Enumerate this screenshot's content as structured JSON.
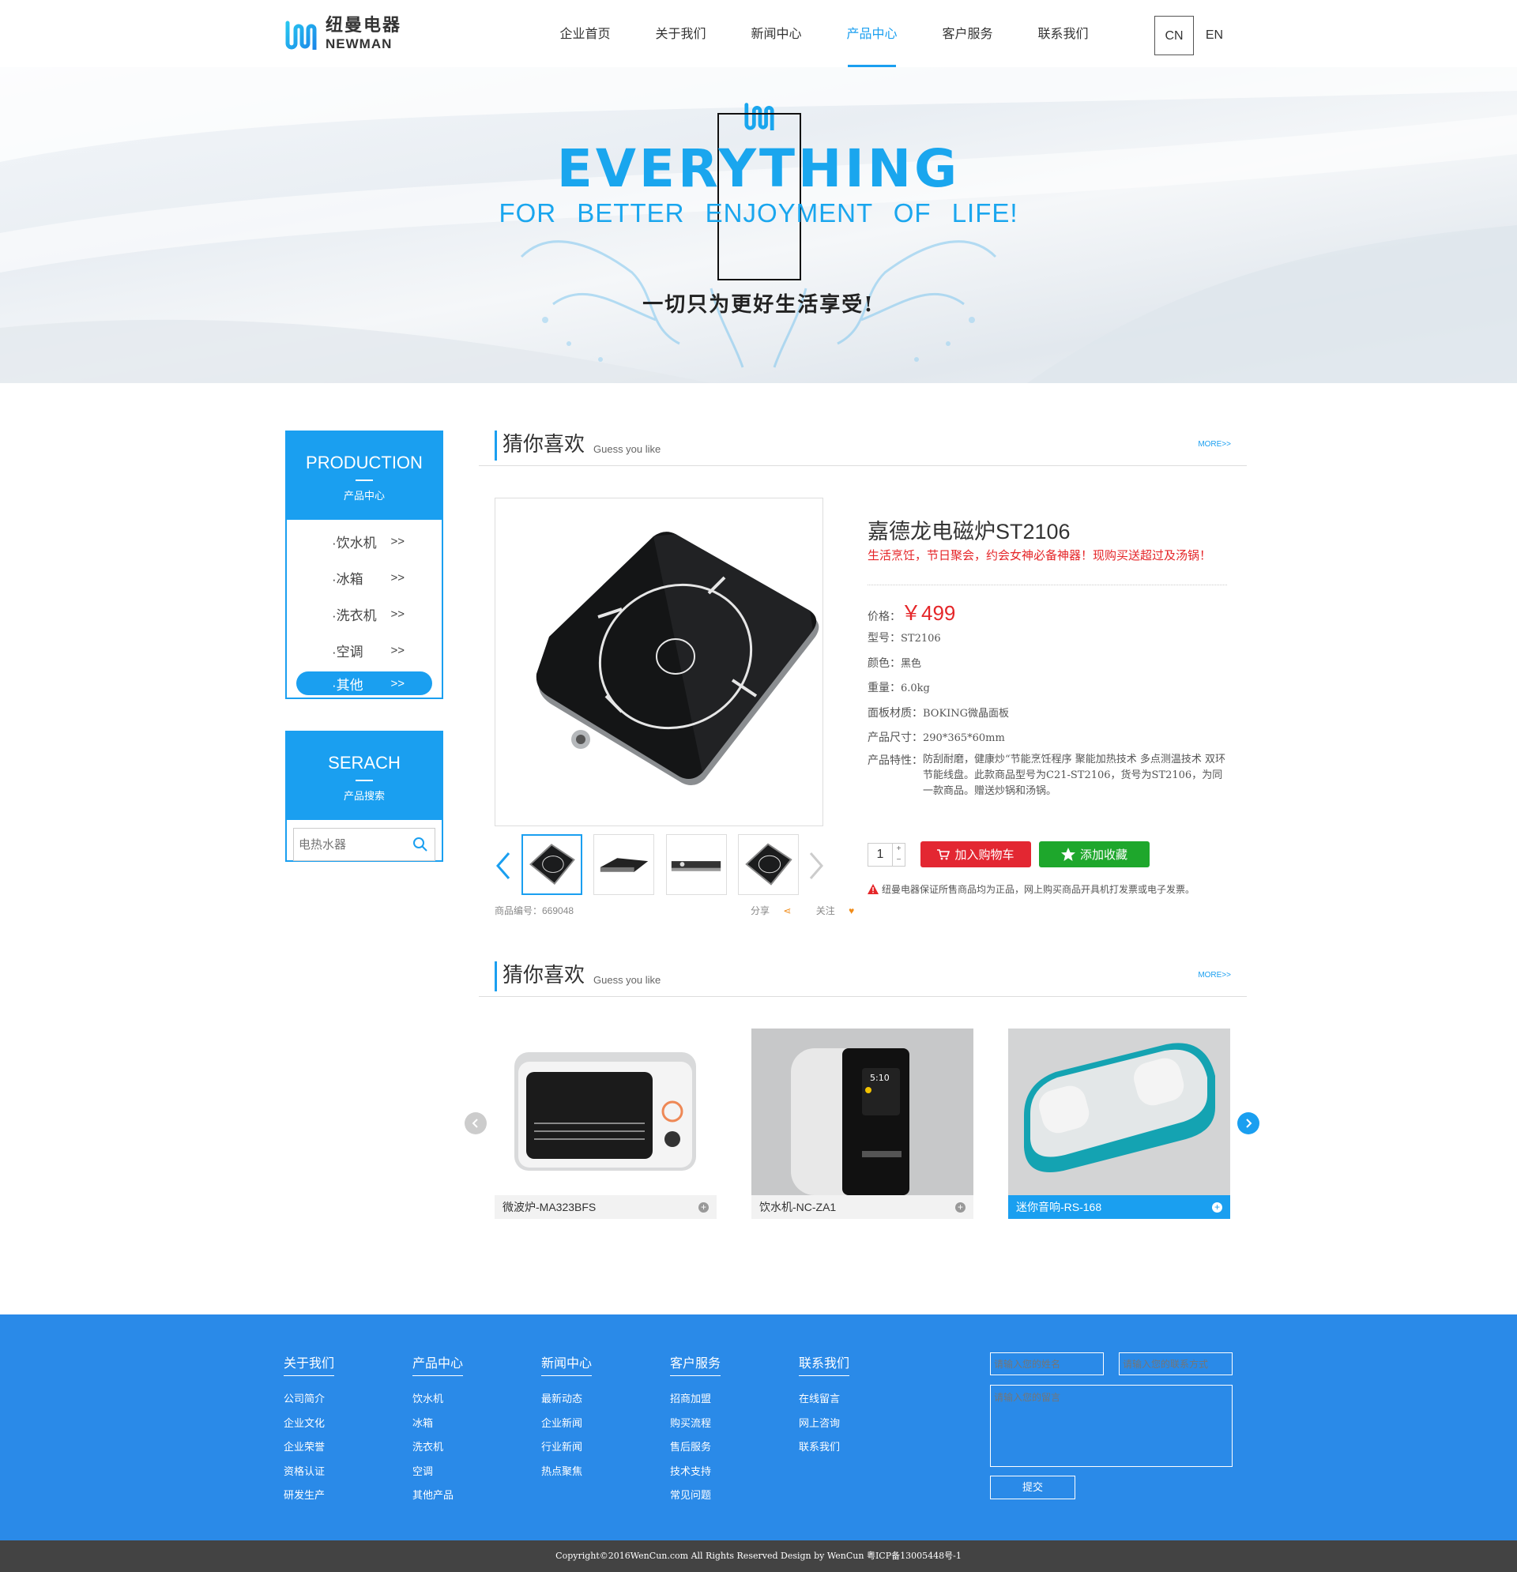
{
  "header": {
    "logo_cn": "纽曼电器",
    "logo_en": "NEWMAN",
    "nav": [
      "企业首页",
      "关于我们",
      "新闻中心",
      "产品中心",
      "客户服务",
      "联系我们"
    ],
    "active_nav": "产品中心",
    "lang": [
      "CN",
      "EN"
    ]
  },
  "banner": {
    "title": "EVERYTHING",
    "subtitle": "FOR BETTER ENJOYMENT OF LIFE!",
    "tagline_cn": "一切只为更好生活享受!"
  },
  "sidebar": {
    "production": {
      "title": "PRODUCTION",
      "subtitle": "产品中心",
      "items": [
        {
          "label": "·饮水机",
          "arrow": ">>"
        },
        {
          "label": "·冰箱",
          "arrow": ">>"
        },
        {
          "label": "·洗衣机",
          "arrow": ">>"
        },
        {
          "label": "·空调",
          "arrow": ">>"
        },
        {
          "label": "·其他",
          "arrow": ">>"
        }
      ],
      "active_item": "·其他"
    },
    "search": {
      "title": "SERACH",
      "subtitle": "产品搜索",
      "placeholder": "电热水器"
    }
  },
  "section1": {
    "title": "猜你喜欢",
    "subtitle": "Guess you like",
    "more": "MORE>>"
  },
  "product": {
    "title": "嘉德龙电磁炉ST2106",
    "slogan": "生活烹饪，节日聚会，约会女神必备神器！现购买送超过及汤锅！",
    "price_label": "价格：",
    "price": "￥499",
    "specs": [
      {
        "k": "型号：",
        "v": "ST2106"
      },
      {
        "k": "颜色：",
        "v": "黑色"
      },
      {
        "k": "重量：",
        "v": "6.0kg"
      },
      {
        "k": "面板材质：",
        "v": "BOKING微晶面板"
      },
      {
        "k": "产品尺寸：",
        "v": "290*365*60mm"
      }
    ],
    "feature_label": "产品特性：",
    "feature_text": "防刮耐磨，健康炒“节能烹饪程序 聚能加热技术 多点测温技术 双环节能线盘。此款商品型号为C21-ST2106，货号为ST2106，为同一款商品。赠送炒锅和汤锅。",
    "quantity": "1",
    "qty_up": "+",
    "qty_down": "−",
    "add_cart": "加入购物车",
    "add_fav": "添加收藏",
    "notice": "纽曼电器保证所售商品均为正品，网上购买商品开具机打发票或电子发票。",
    "sku_label": "商品编号：669048",
    "share": "分享",
    "follow": "关注"
  },
  "section2": {
    "title": "猜你喜欢",
    "subtitle": "Guess you like",
    "more": "MORE>>"
  },
  "recommend": [
    {
      "name": "微波炉-MA323BFS",
      "plus": "+"
    },
    {
      "name": "饮水机-NC-ZA1",
      "plus": "+"
    },
    {
      "name": "迷你音响-RS-168",
      "plus": "+"
    }
  ],
  "footer": {
    "columns": [
      {
        "title": "关于我们",
        "links": [
          "公司简介",
          "企业文化",
          "企业荣誉",
          "资格认证",
          "研发生产"
        ]
      },
      {
        "title": "产品中心",
        "links": [
          "饮水机",
          "冰箱",
          "洗衣机",
          "空调",
          "其他产品"
        ]
      },
      {
        "title": "新闻中心",
        "links": [
          "最新动态",
          "企业新闻",
          "行业新闻",
          "热点聚焦"
        ]
      },
      {
        "title": "客户服务",
        "links": [
          "招商加盟",
          "购买流程",
          "售后服务",
          "技术支持",
          "常见问题"
        ]
      },
      {
        "title": "联系我们",
        "links": [
          "在线留言",
          "网上咨询",
          "联系我们"
        ]
      }
    ],
    "form": {
      "name_placeholder": "请输入您的姓名",
      "contact_placeholder": "请输入您的联系方式",
      "message_placeholder": "请输入您的留言",
      "submit": "提交"
    },
    "copyright": "Copyright©2016WenCun.com All Rights Reserved Design by WenCun 粤ICP备13005448号-1"
  },
  "colors": {
    "accent": "#1a9ff0",
    "footer": "#2a8ae8",
    "price": "#e52629",
    "cart": "#e32732",
    "fav": "#1ea72c"
  }
}
